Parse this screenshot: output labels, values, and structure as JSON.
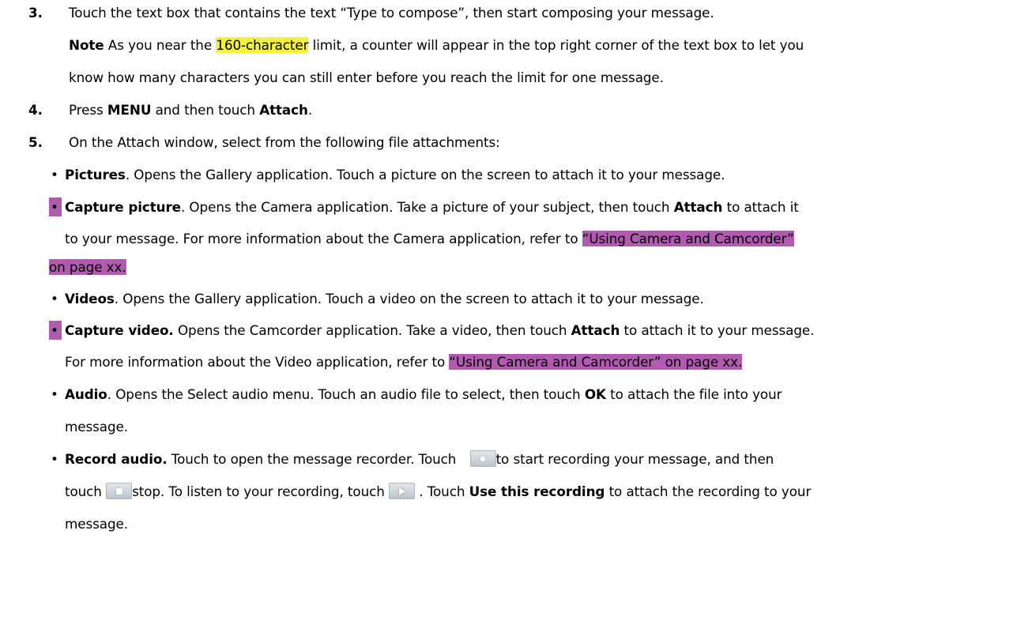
{
  "steps": [
    {
      "number": "3.",
      "text": "Touch the text box that contains the text “Type to compose”, then start composing your message."
    },
    {
      "number": "4."
    },
    {
      "number": "5.",
      "text": "On the Attach window, select from the following file attachments:"
    }
  ],
  "note": {
    "label": "Note",
    "pre": " As you near the ",
    "highlight": "160-character",
    "post": " limit, a counter will appear in the top right corner of the text box to let you",
    "line2": "know how many characters you can still enter before you reach the limit for one message."
  },
  "step4": {
    "pre": "Press ",
    "key1": "MENU",
    "mid": " and then touch ",
    "key2": "Attach",
    "post": "."
  },
  "bullet_glyph": "•",
  "items": {
    "pictures": {
      "title": "Pictures",
      "text": ". Opens the Gallery application. Touch a picture on the screen to attach it to your message."
    },
    "capture_picture": {
      "title": "Capture picture",
      "text1": ". Opens the Camera application. Take a picture of your subject, then touch ",
      "attach": "Attach",
      "text2": " to attach it",
      "line2_pre": "to your message. For more information about the Camera application, refer to ",
      "ref1": " “Using Camera and Camcorder”",
      "ref2": "on page xx."
    },
    "videos": {
      "title": "Videos",
      "text": ". Opens the Gallery application. Touch a video on the screen to attach it to your message."
    },
    "capture_video": {
      "title": "Capture video.",
      "text1": " Opens the Camcorder application. Take a video, then touch ",
      "attach": "Attach",
      "text2": " to attach it to your message.",
      "line2_pre": "For more information about the Video application, refer to ",
      "ref": " “Using Camera and  Camcorder” on page xx."
    },
    "audio": {
      "title": "Audio",
      "text1": ". Opens the Select audio menu. Touch an audio file to select, then touch ",
      "ok": "OK",
      "text2": " to attach the file into your",
      "line2": "message."
    },
    "record_audio": {
      "title": "Record audio.",
      "text1": " Touch to open the message recorder. Touch ",
      "text2": "to start recording your message, and then",
      "line2_pre": "touch ",
      "line2_stop": "stop. To listen to your recording, touch ",
      "line2_mid": " . Touch ",
      "use": "Use this recording",
      "line2_post": " to attach the recording to your",
      "line3": "message."
    }
  },
  "icons": {
    "record": "record-button-icon",
    "stop": "stop-button-icon",
    "play": "play-button-icon"
  },
  "colors": {
    "yellow_highlight": "#f3f13a",
    "purple_highlight": "#b05ab0"
  }
}
